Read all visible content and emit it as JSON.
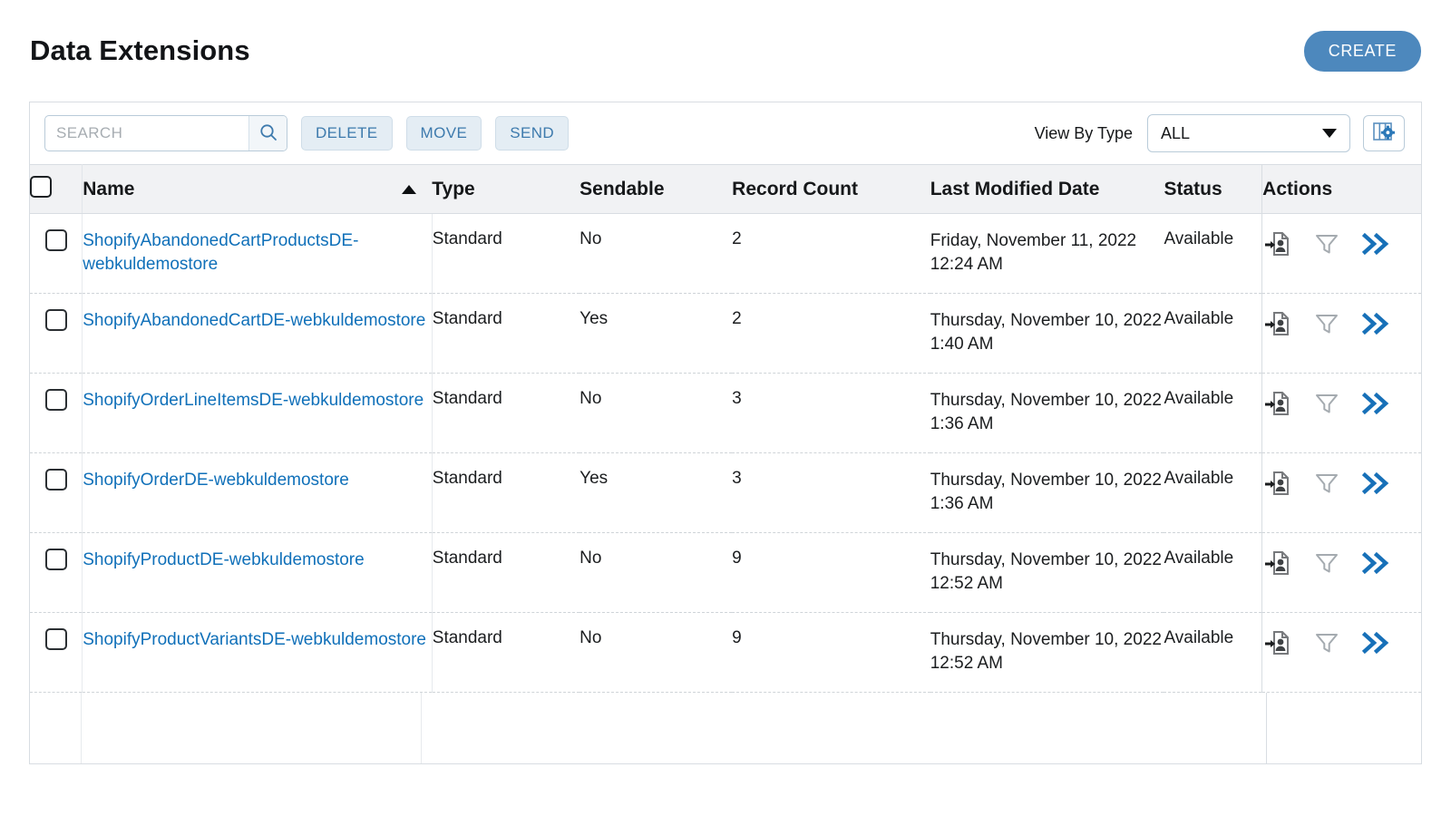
{
  "header": {
    "title": "Data Extensions",
    "create_label": "CREATE",
    "create_color": "#4d88bd"
  },
  "toolbar": {
    "search_placeholder": "SEARCH",
    "search_value": "",
    "search_icon": "search-icon",
    "delete_label": "DELETE",
    "move_label": "MOVE",
    "send_label": "SEND",
    "view_by_type_label": "View By Type",
    "type_filter_value": "ALL",
    "type_filter_options": [
      "ALL"
    ],
    "columns_settings_icon": "columns-gear-icon",
    "button_text_color": "#3d7aad"
  },
  "table": {
    "sort_column": "Name",
    "sort_direction": "ascending",
    "select_all_checked": false,
    "columns": [
      {
        "key": "checkbox",
        "label": ""
      },
      {
        "key": "name",
        "label": "Name"
      },
      {
        "key": "type",
        "label": "Type"
      },
      {
        "key": "sendable",
        "label": "Sendable"
      },
      {
        "key": "record_count",
        "label": "Record Count"
      },
      {
        "key": "last_modified",
        "label": "Last Modified Date"
      },
      {
        "key": "status",
        "label": "Status"
      },
      {
        "key": "actions",
        "label": "Actions"
      }
    ],
    "row_action_icons": [
      {
        "name": "import-contacts-icon",
        "color": "#6b6f73"
      },
      {
        "name": "filter-funnel-icon",
        "color": "#9aa0a5"
      },
      {
        "name": "more-actions-chevrons-icon",
        "color": "#1770b8"
      }
    ],
    "rows": [
      {
        "checked": false,
        "name": "ShopifyAbandonedCartProductsDE-webkuldemostore",
        "type": "Standard",
        "sendable": "No",
        "record_count": "2",
        "last_modified": "Friday, November 11, 2022 12:24 AM",
        "status": "Available"
      },
      {
        "checked": false,
        "name": "ShopifyAbandonedCartDE-webkuldemostore",
        "type": "Standard",
        "sendable": "Yes",
        "record_count": "2",
        "last_modified": "Thursday, November 10, 2022 1:40 AM",
        "status": "Available"
      },
      {
        "checked": false,
        "name": "ShopifyOrderLineItemsDE-webkuldemostore",
        "type": "Standard",
        "sendable": "No",
        "record_count": "3",
        "last_modified": "Thursday, November 10, 2022 1:36 AM",
        "status": "Available"
      },
      {
        "checked": false,
        "name": "ShopifyOrderDE-webkuldemostore",
        "type": "Standard",
        "sendable": "Yes",
        "record_count": "3",
        "last_modified": "Thursday, November 10, 2022 1:36 AM",
        "status": "Available"
      },
      {
        "checked": false,
        "name": "ShopifyProductDE-webkuldemostore",
        "type": "Standard",
        "sendable": "No",
        "record_count": "9",
        "last_modified": "Thursday, November 10, 2022 12:52 AM",
        "status": "Available"
      },
      {
        "checked": false,
        "name": "ShopifyProductVariantsDE-webkuldemostore",
        "type": "Standard",
        "sendable": "No",
        "record_count": "9",
        "last_modified": "Thursday, November 10, 2022 12:52 AM",
        "status": "Available"
      }
    ]
  }
}
